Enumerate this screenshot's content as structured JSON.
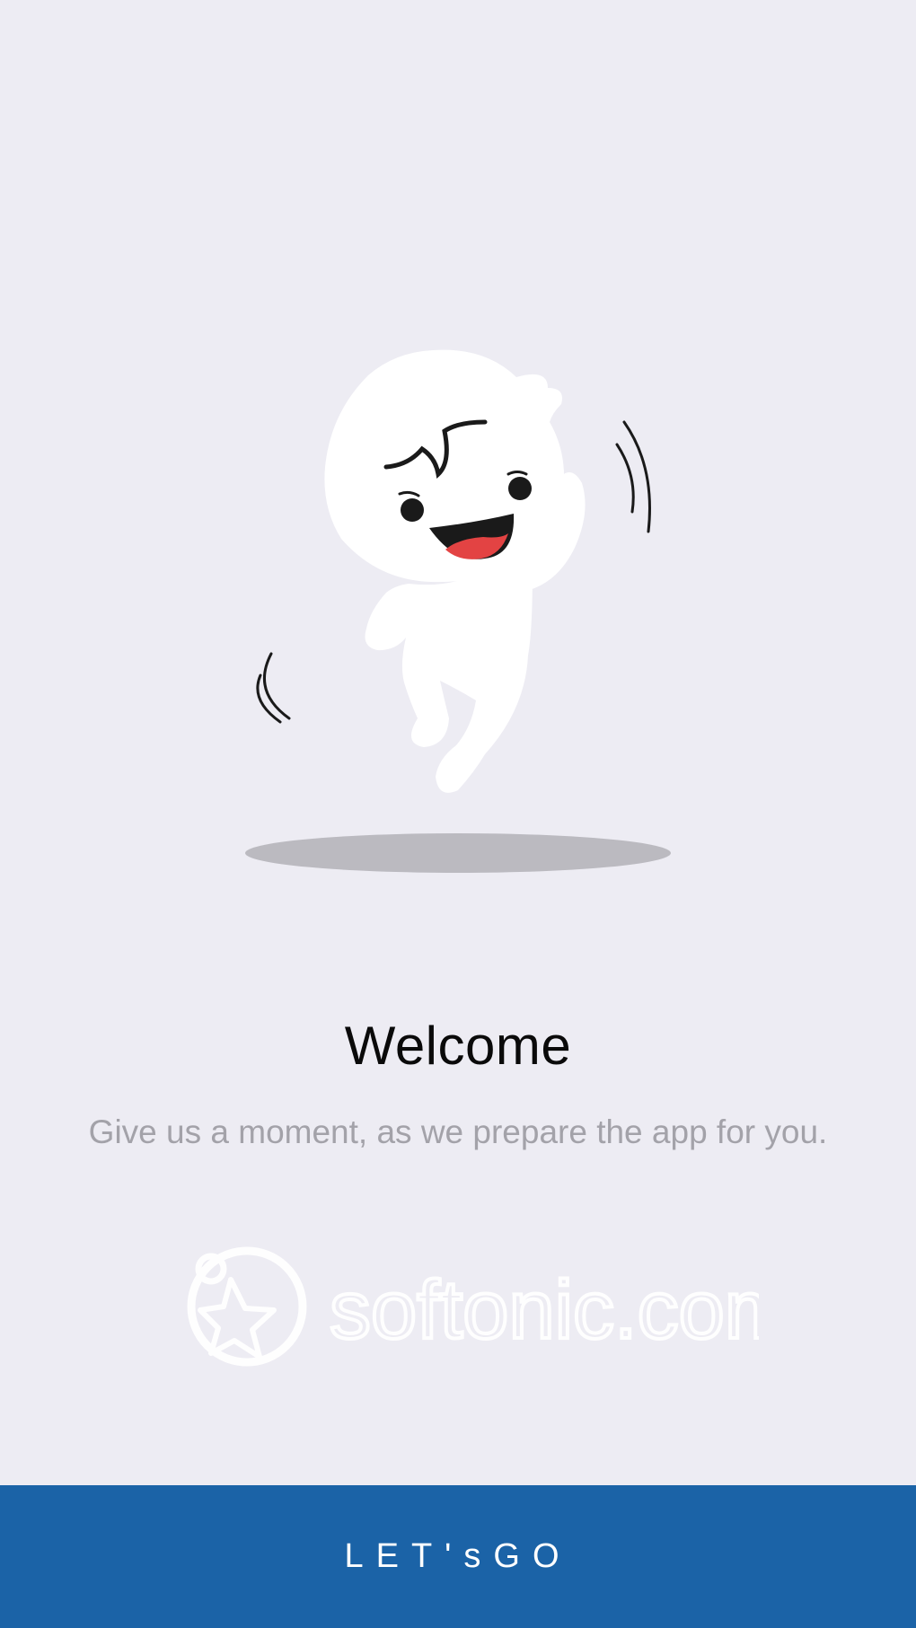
{
  "welcome": {
    "title": "Welcome",
    "subtitle": "Give us a moment, as we prepare the app for you."
  },
  "watermark": {
    "text": "softonic.com"
  },
  "cta": {
    "label": "LET'sGO"
  },
  "colors": {
    "background": "#edecf3",
    "cta_background": "#1b63a7",
    "cta_text": "#ffffff",
    "title_text": "#0a0a0a",
    "subtitle_text": "#a3a2a9",
    "mouth_red": "#e34343",
    "shadow": "#bbbac0"
  },
  "icons": {
    "mascot": "jumping-mascot-illustration",
    "watermark_logo": "softonic-star-logo"
  }
}
